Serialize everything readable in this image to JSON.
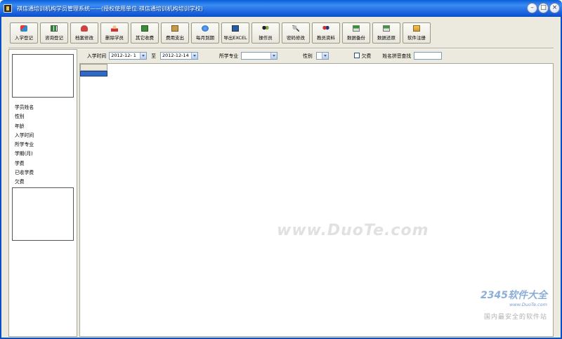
{
  "window": {
    "title": "祺信通培训机构学员管理系统——(授权使用单位:祺信通培训机构培训学校)",
    "controls": {
      "minimize": "–",
      "maximize": "□",
      "close": "×"
    }
  },
  "toolbar": {
    "items": [
      {
        "id": "enroll",
        "label": "入学登记",
        "icon": "pen-icon"
      },
      {
        "id": "consult",
        "label": "咨询登记",
        "icon": "grid-icon"
      },
      {
        "id": "archive",
        "label": "档案修改",
        "icon": "edit-icon"
      },
      {
        "id": "delete",
        "label": "删除学员",
        "icon": "user-icon"
      },
      {
        "id": "other-fee",
        "label": "其它收费",
        "icon": "money-icon"
      },
      {
        "id": "expense",
        "label": "费用支出",
        "icon": "box-icon"
      },
      {
        "id": "monthly",
        "label": "每月到期",
        "icon": "globe-icon"
      },
      {
        "id": "export",
        "label": "导出EXCEL",
        "icon": "screen-icon"
      },
      {
        "id": "operator",
        "label": "操作员",
        "icon": "people-icon"
      },
      {
        "id": "password",
        "label": "密码修改",
        "icon": "key-icon"
      },
      {
        "id": "teacher",
        "label": "教员资料",
        "icon": "team-icon"
      },
      {
        "id": "backup",
        "label": "数据备份",
        "icon": "backup-icon"
      },
      {
        "id": "restore",
        "label": "数据还原",
        "icon": "restore-icon"
      },
      {
        "id": "register",
        "label": "软件注册",
        "icon": "register-icon"
      }
    ]
  },
  "student_info": {
    "labels": [
      "学员姓名",
      "性别",
      "年龄",
      "入学时间",
      "所学专业",
      "学期(月)",
      "学费",
      "已收学费",
      "欠费"
    ]
  },
  "filters": {
    "enroll_time_label": "入学时间",
    "date_from": "2012-12- 1",
    "to_label": "至",
    "date_to": "2012-12-14",
    "major_label": "所学专业",
    "major_value": "",
    "gender_label": "性别",
    "gender_value": "",
    "arrears_label": "欠费",
    "pinyin_label": "姓名拼音查找",
    "pinyin_value": ""
  },
  "watermark": {
    "text": "www.DuoTe.com",
    "corner_brand": "2345软件大全",
    "corner_site": "www.DuoTe.com",
    "corner_tagline": "国内最安全的软件站"
  }
}
